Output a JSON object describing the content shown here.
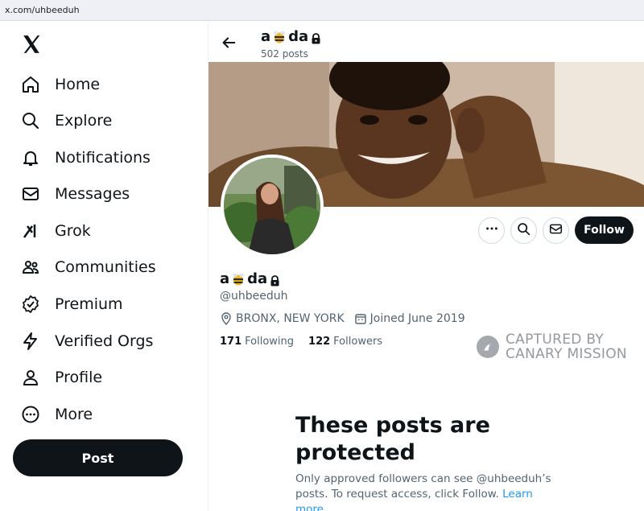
{
  "browser": {
    "url": "x.com/uhbeeduh"
  },
  "sidebar": {
    "logo": "x-logo-icon",
    "items": [
      {
        "label": "Home",
        "icon": "home-icon"
      },
      {
        "label": "Explore",
        "icon": "search-icon"
      },
      {
        "label": "Notifications",
        "icon": "bell-icon"
      },
      {
        "label": "Messages",
        "icon": "envelope-icon"
      },
      {
        "label": "Grok",
        "icon": "grok-icon"
      },
      {
        "label": "Communities",
        "icon": "people-icon"
      },
      {
        "label": "Premium",
        "icon": "verified-badge-icon"
      },
      {
        "label": "Verified Orgs",
        "icon": "lightning-icon"
      },
      {
        "label": "Profile",
        "icon": "person-icon"
      },
      {
        "label": "More",
        "icon": "more-circle-icon"
      }
    ],
    "post_label": "Post"
  },
  "header": {
    "name_start": "a",
    "name_end": "da",
    "name_emoji": "bee-icon",
    "posts_count": "502 posts"
  },
  "profile": {
    "name_start": "a",
    "name_end": "da",
    "handle": "@uhbeeduh",
    "location": "BRONX, NEW YORK",
    "joined": "Joined June 2019",
    "following_count": "171",
    "following_label": "Following",
    "followers_count": "122",
    "followers_label": "Followers",
    "follow_label": "Follow"
  },
  "watermark": {
    "line1": "CAPTURED BY",
    "line2": "CANARY MISSION"
  },
  "protected": {
    "title": "These posts are protected",
    "desc": "Only approved followers can see @uhbeeduh’s posts. To request access, click Follow.",
    "link": "Learn more"
  },
  "colors": {
    "text": "#0f1419",
    "muted": "#536471",
    "link": "#1d9bf0",
    "button": "#0f1419"
  }
}
